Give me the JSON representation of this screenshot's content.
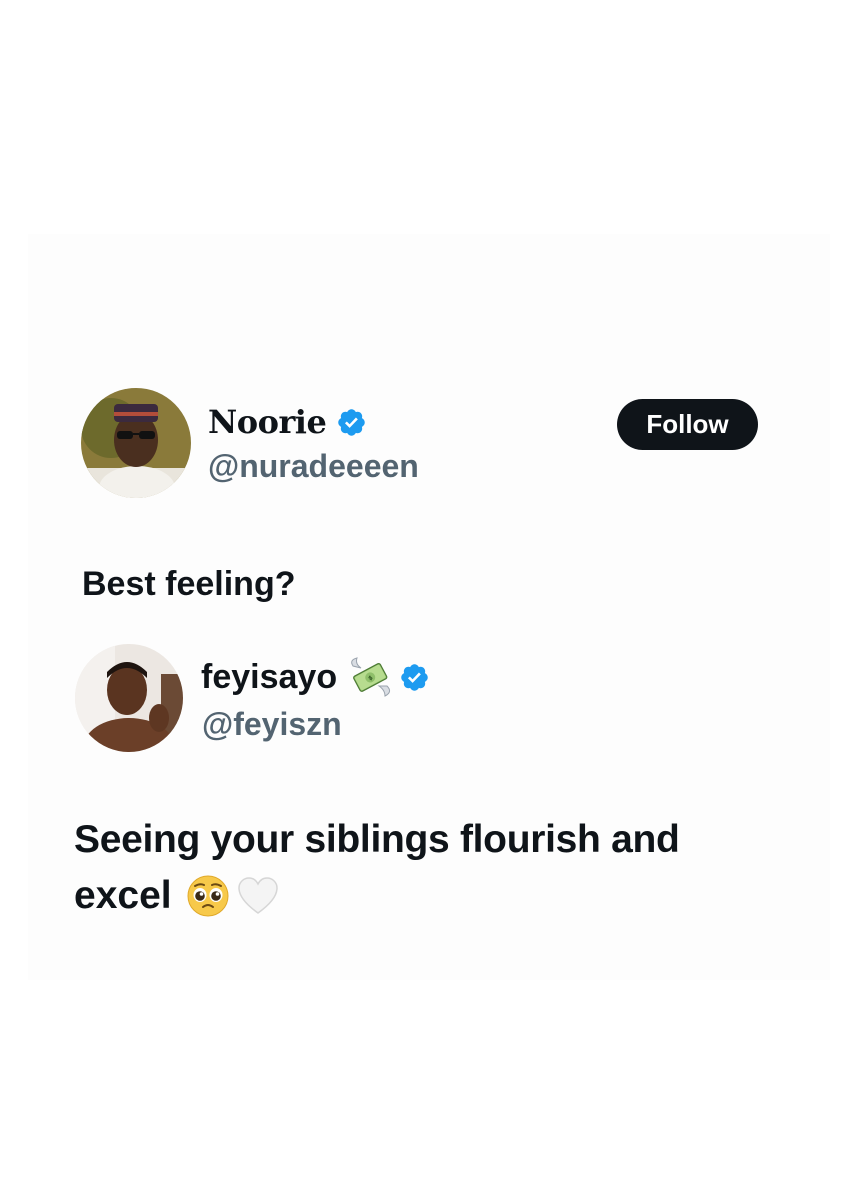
{
  "post1": {
    "display_name": "Noorie",
    "handle": "@nuradeeeen",
    "verified_icon": "verified-badge-icon",
    "follow_label": "Follow",
    "text": "Best feeling?"
  },
  "post2": {
    "display_name": "feyisayo",
    "name_emoji_icon": "money-with-wings-icon",
    "verified_icon": "verified-badge-icon",
    "handle": "@feyiszn",
    "text_line1": "Seeing your siblings flourish and",
    "text_line2": "excel",
    "emoji_icons": [
      "pleading-face-icon",
      "white-heart-icon"
    ]
  },
  "colors": {
    "verified_blue": "#1d9bf0",
    "text": "#0f1419",
    "handle_gray": "#536471",
    "button_bg": "#0f1419"
  }
}
